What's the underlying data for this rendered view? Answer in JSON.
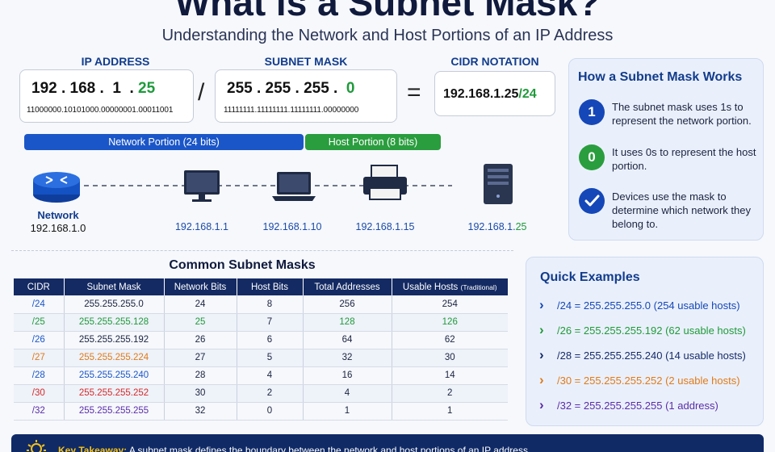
{
  "header": {
    "title": "What is a Subnet Mask?",
    "subtitle": "Understanding the Network and Host Portions of an IP Address"
  },
  "ip_address": {
    "heading": "IP ADDRESS",
    "octets_network": "192 . 168 .  1  .",
    "octet_host": "25",
    "binary": "11000000.10101000.00000001.00011001"
  },
  "slash_symbol": "/",
  "subnet_mask": {
    "heading": "SUBNET MASK",
    "octets_network": "255 . 255 . 255 .",
    "octet_host": "0",
    "binary": "11111111.11111111.11111111.00000000"
  },
  "equals_symbol": "=",
  "cidr": {
    "heading": "CIDR NOTATION",
    "address": "192.168.1.25",
    "suffix": "/24"
  },
  "portions": {
    "network_label": "Network Portion (24 bits)",
    "host_label": "Host Portion (8 bits)",
    "network_color": "#1b56c8",
    "host_color": "#2a9d3e"
  },
  "devices": {
    "router": {
      "icon": "router-icon",
      "label": "Network",
      "address": "192.168.1.0"
    },
    "items": [
      {
        "icon": "monitor-icon",
        "address": "192.168.1.1"
      },
      {
        "icon": "laptop-icon",
        "address": "192.168.1.10"
      },
      {
        "icon": "printer-icon",
        "address": "192.168.1.15"
      },
      {
        "icon": "server-icon",
        "address_net": "192.168.1.",
        "address_host": "25"
      }
    ]
  },
  "how_it_works": {
    "title": "How a Subnet Mask Works",
    "steps": [
      {
        "badge": "1",
        "text": "The subnet mask uses 1s to represent the network portion.",
        "color": "#1547b8"
      },
      {
        "badge": "0",
        "text": "It uses 0s to represent the host portion.",
        "color": "#2a9d3e"
      },
      {
        "badge": "check-icon",
        "text": "Devices use the mask to determine which network they belong to.",
        "color": "#1547b8"
      }
    ]
  },
  "common_masks": {
    "title": "Common Subnet Masks",
    "columns": [
      "CIDR",
      "Subnet Mask",
      "Network Bits",
      "Host Bits",
      "Total Addresses",
      "Usable Hosts"
    ],
    "usable_note": "(Traditional)",
    "rows": [
      {
        "cidr": "/24",
        "mask": "255.255.255.0",
        "net": "24",
        "host": "8",
        "total": "256",
        "usable": "254",
        "color": "#1b56c8"
      },
      {
        "cidr": "/25",
        "mask": "255.255.255.128",
        "net": "25",
        "host": "7",
        "total": "128",
        "usable": "126",
        "color": "#1f9a3b"
      },
      {
        "cidr": "/26",
        "mask": "255.255.255.192",
        "net": "26",
        "host": "6",
        "total": "64",
        "usable": "62",
        "color": "#1b56c8"
      },
      {
        "cidr": "/27",
        "mask": "255.255.255.224",
        "net": "27",
        "host": "5",
        "total": "32",
        "usable": "30",
        "color": "#e07a1a"
      },
      {
        "cidr": "/28",
        "mask": "255.255.255.240",
        "net": "28",
        "host": "4",
        "total": "16",
        "usable": "14",
        "color": "#1b56c8"
      },
      {
        "cidr": "/30",
        "mask": "255.255.255.252",
        "net": "30",
        "host": "2",
        "total": "4",
        "usable": "2",
        "color": "#d42a2a"
      },
      {
        "cidr": "/32",
        "mask": "255.255.255.255",
        "net": "32",
        "host": "0",
        "total": "1",
        "usable": "1",
        "color": "#5a2ca8"
      }
    ]
  },
  "quick_examples": {
    "title": "Quick Examples",
    "items": [
      {
        "text": "/24 = 255.255.255.0 (254 usable hosts)",
        "color": "#1547b8"
      },
      {
        "text": "/26 = 255.255.255.192 (62 usable hosts)",
        "color": "#1f9a3b"
      },
      {
        "text": "/28 = 255.255.255.240 (14 usable hosts)",
        "color": "#152a6a"
      },
      {
        "text": "/30 = 255.255.255.252 (2 usable hosts)",
        "color": "#e07a1a"
      },
      {
        "text": "/32 = 255.255.255.255 (1 address)",
        "color": "#5a2ca8"
      }
    ]
  },
  "takeaway": {
    "label": "Key Takeaway:",
    "text": "A subnet mask defines the boundary between the network and host portions of an IP address."
  }
}
